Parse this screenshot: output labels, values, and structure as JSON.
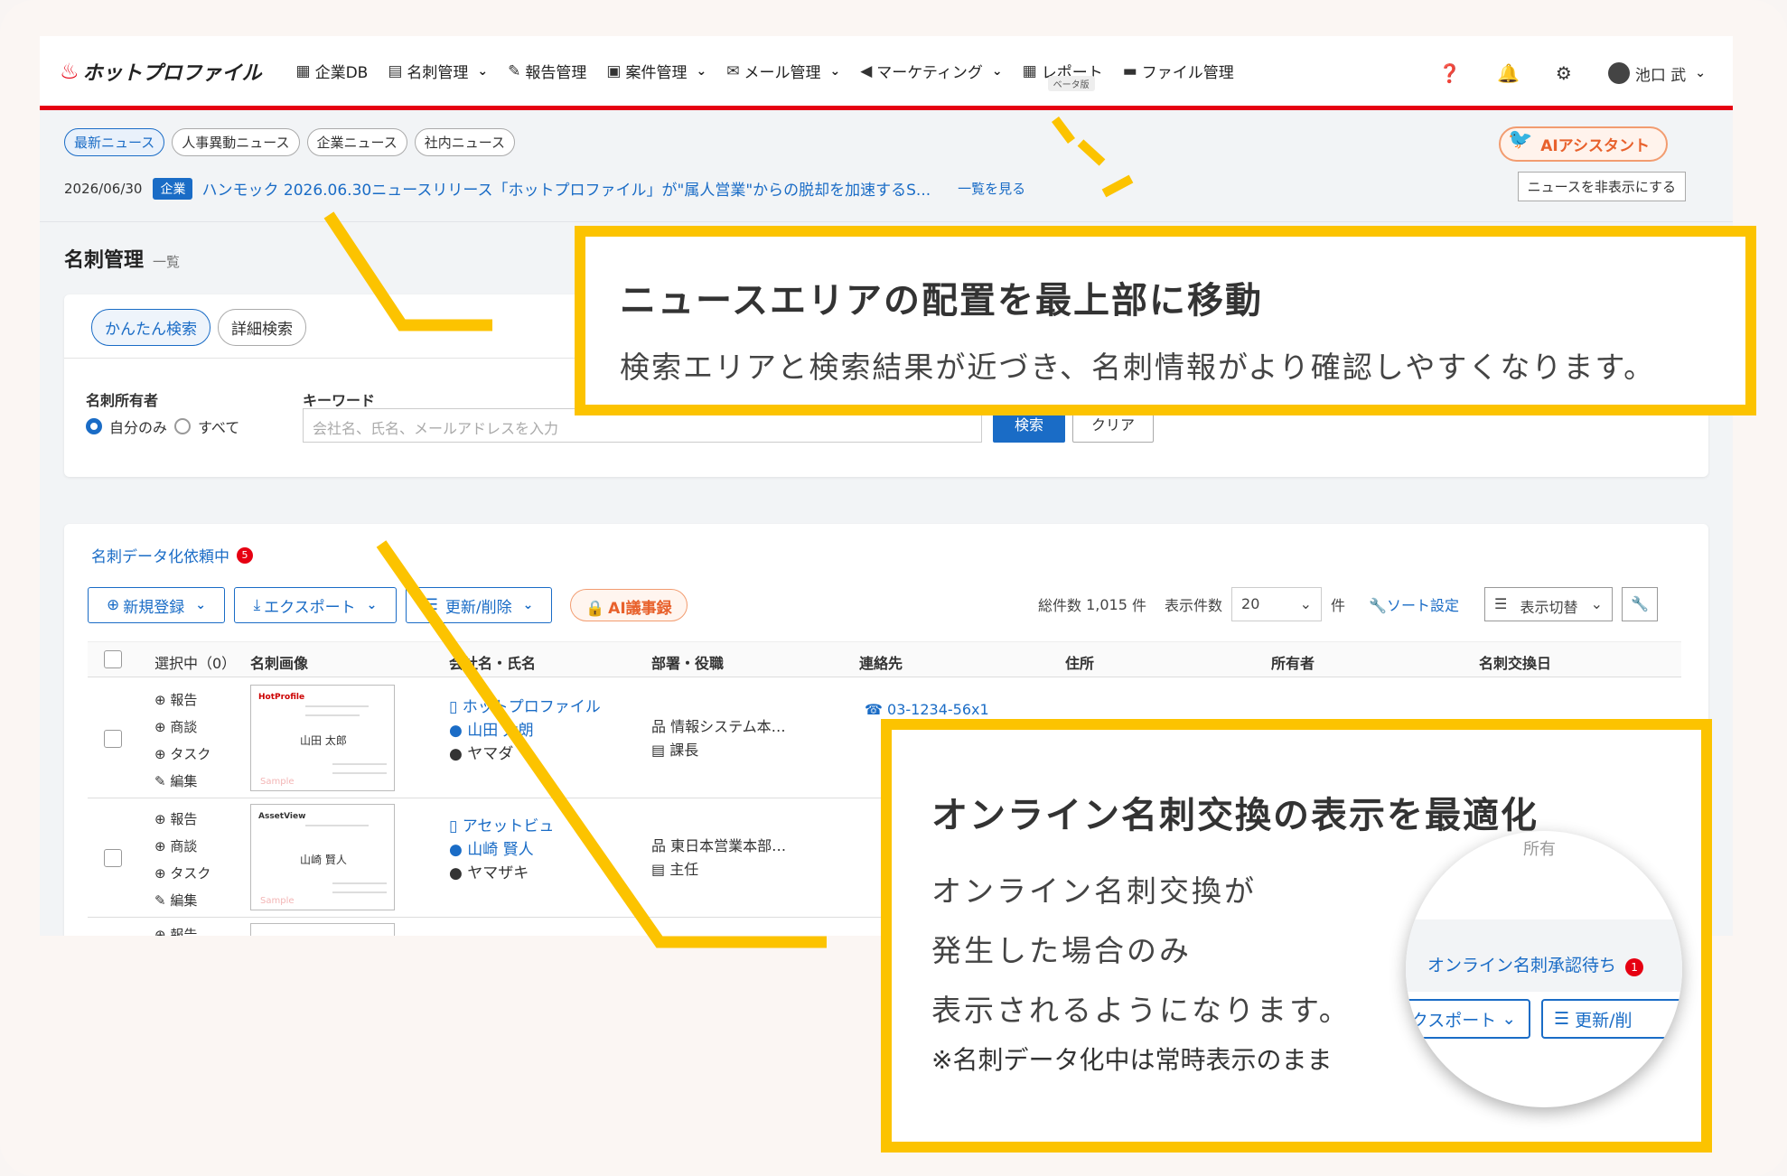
{
  "nav": {
    "logo": "ホットプロファイル",
    "items": [
      {
        "label": "企業DB",
        "icon": "building-icon",
        "dropdown": false
      },
      {
        "label": "名刺管理",
        "icon": "id-card-icon",
        "dropdown": true
      },
      {
        "label": "報告管理",
        "icon": "edit-icon",
        "dropdown": false
      },
      {
        "label": "案件管理",
        "icon": "briefcase-icon",
        "dropdown": true
      },
      {
        "label": "メール管理",
        "icon": "envelope-icon",
        "dropdown": true
      },
      {
        "label": "マーケティング",
        "icon": "megaphone-icon",
        "dropdown": true
      },
      {
        "label": "レポート",
        "icon": "table-icon",
        "dropdown": false
      },
      {
        "label": "ファイル管理",
        "icon": "folder-icon",
        "dropdown": false
      }
    ],
    "beta_label": "ベータ版",
    "user_name": "池口 武"
  },
  "news": {
    "tabs": [
      "最新ニュース",
      "人事異動ニュース",
      "企業ニュース",
      "社内ニュース"
    ],
    "date": "2026/06/30",
    "badge": "企業",
    "headline": "ハンモック 2026.06.30ニュースリリース「ホットプロファイル」が\"属人営業\"からの脱却を加速するS...",
    "more": "一覧を見る",
    "ai_button": "AIアシスタント",
    "hide_button": "ニュースを非表示にする"
  },
  "page": {
    "title": "名刺管理",
    "subtitle": "一覧"
  },
  "search": {
    "tabs": [
      "かんたん検索",
      "詳細検索"
    ],
    "owner_label": "名刺所有者",
    "owner_options": [
      "自分のみ",
      "すべて"
    ],
    "keyword_label": "キーワード",
    "keyword_placeholder": "会社名、氏名、メールアドレスを入力",
    "search_button": "検索",
    "clear_button": "クリア"
  },
  "list": {
    "request_label": "名刺データ化依頼中",
    "request_count": "5",
    "buttons": {
      "new": "新規登録",
      "export": "エクスポート",
      "update": "更新/削除",
      "ai": "AI議事録"
    },
    "total_label": "総件数",
    "total_value": "1,015",
    "total_unit": "件",
    "per_page_label": "表示件数",
    "per_page_value": "20",
    "per_page_unit": "件",
    "sort_label": "ソート設定",
    "view_label": "表示切替",
    "columns": [
      "選択中（0）",
      "名刺画像",
      "会社名・氏名",
      "部署・役職",
      "連絡先",
      "住所",
      "所有者",
      "名刺交換日"
    ],
    "actions": [
      "報告",
      "商談",
      "タスク",
      "編集"
    ],
    "rows": [
      {
        "company": "ホットプロファイル",
        "name": "山田 太朗",
        "kana": "ヤマダ",
        "dept": "情報システム本…",
        "title": "課長",
        "phone": "03-1234-56x1",
        "card_logo": "HotProfile",
        "card_name": "山田 太郎",
        "card_sample": "Sample"
      },
      {
        "company": "アセットビュ",
        "name": "山崎 賢人",
        "kana": "ヤマザキ",
        "dept": "東日本営業本部…",
        "title": "主任",
        "phone": "",
        "card_logo": "AssetView",
        "card_name": "山崎 賢人",
        "card_sample": "Sample"
      }
    ],
    "partial_row_action": "報告"
  },
  "callout_top": {
    "title": "ニュースエリアの配置を最上部に移動",
    "body": "検索エリアと検索結果が近づき、名刺情報がより確認しやすくなります。"
  },
  "callout_bottom": {
    "title": "オンライン名刺交換の表示を最適化",
    "lines": [
      "オンライン名刺交換が",
      "発生した場合のみ",
      "表示されるようになります。"
    ],
    "note": "※名刺データ化中は常時表示のまま",
    "zoom_top": "所有",
    "zoom_label": "オンライン名刺承認待ち",
    "zoom_count": "1",
    "zoom_export": "クスポート",
    "zoom_update": "更新/削"
  },
  "colors": {
    "accent": "#1a6cc6",
    "brand_red": "#e60012",
    "callout_yellow": "#fcc300",
    "ai_orange": "#e8612c"
  }
}
